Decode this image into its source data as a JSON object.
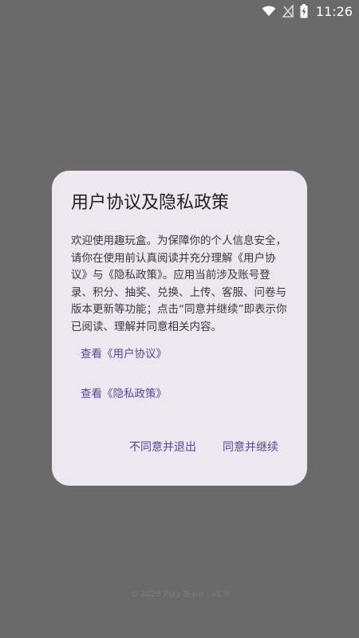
{
  "status_bar": {
    "time": "11:26",
    "wifi_icon": "wifi-icon",
    "signal_icon": "no-signal-icon",
    "battery_icon": "battery-charging-icon"
  },
  "dialog": {
    "title": "用户协议及隐私政策",
    "body": "欢迎使用趣玩盒。为保障你的个人信息安全，请你在使用前认真阅读并充分理解《用户协议》与《隐私政策》。应用当前涉及账号登录、积分、抽奖、兑换、上传、客服、问卷与版本更新等功能；点击“同意并继续”即表示你已阅读、理解并同意相关内容。",
    "link_user_agreement": "查看《用户协议》",
    "link_privacy_policy": "查看《隐私政策》",
    "disagree_button": "不同意并退出",
    "agree_button": "同意并继续"
  },
  "footer": {
    "text": "© 2026 Play Team · v1.0"
  },
  "colors": {
    "scrim": "#6a6a6a",
    "dialog_bg": "#ece7f0",
    "accent": "#5b4a8d"
  }
}
